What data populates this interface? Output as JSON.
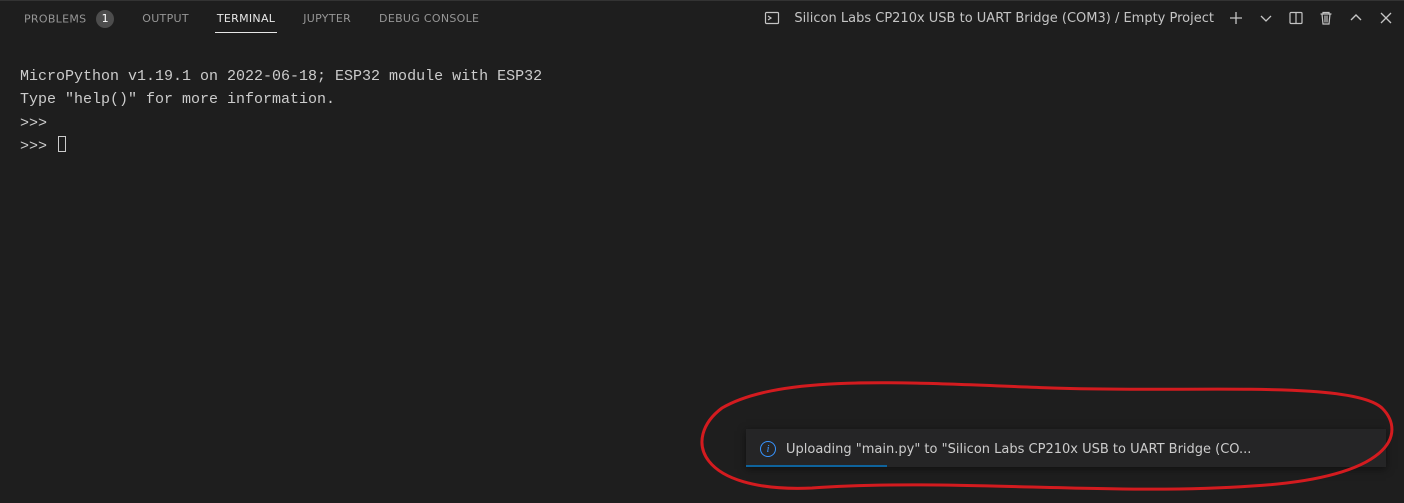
{
  "tabs": {
    "problems": {
      "label": "PROBLEMS",
      "badge": "1"
    },
    "output": {
      "label": "OUTPUT"
    },
    "terminal": {
      "label": "TERMINAL"
    },
    "jupyter": {
      "label": "JUPYTER"
    },
    "debug": {
      "label": "DEBUG CONSOLE"
    }
  },
  "terminal_profile": "Silicon Labs CP210x USB to UART Bridge (COM3) / Empty Project",
  "terminal": {
    "lines": [
      "MicroPython v1.19.1 on 2022-06-18; ESP32 module with ESP32",
      "Type \"help()\" for more information.",
      ">>> ",
      ">>> "
    ]
  },
  "toast": {
    "message": "Uploading \"main.py\" to \"Silicon Labs CP210x USB to UART Bridge (CO...",
    "progress_percent": 22
  },
  "colors": {
    "accent": "#3794ff",
    "annotation": "#d31b1f"
  }
}
